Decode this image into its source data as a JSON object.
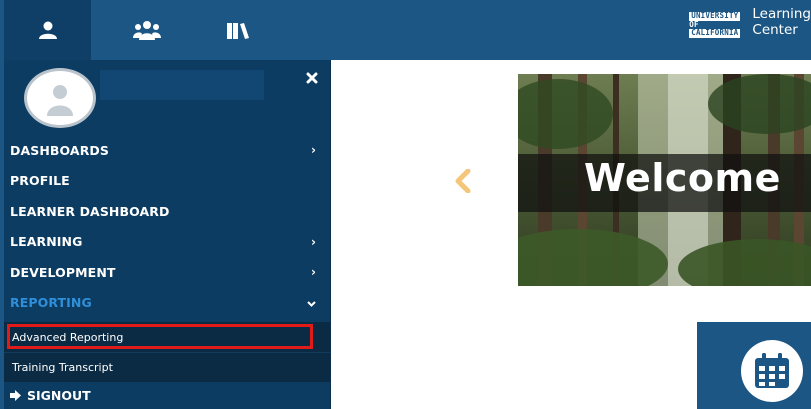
{
  "topbar": {
    "tabs": [
      {
        "icon": "user-icon",
        "active": true
      },
      {
        "icon": "users-group-icon",
        "active": false
      },
      {
        "icon": "books-icon",
        "active": false
      }
    ],
    "logo": {
      "line1": "UNIVERSITY",
      "line2": "OF",
      "line3": "CALIFORNIA"
    },
    "app_title_line1": "Learning",
    "app_title_line2": "Center"
  },
  "sidebar": {
    "close_icon": "close-icon",
    "nav": [
      {
        "label": "DASHBOARDS",
        "chevron": "right"
      },
      {
        "label": "PROFILE",
        "chevron": null
      },
      {
        "label": "LEARNER DASHBOARD",
        "chevron": null
      },
      {
        "label": "LEARNING",
        "chevron": "right"
      },
      {
        "label": "DEVELOPMENT",
        "chevron": "right"
      },
      {
        "label": "REPORTING",
        "chevron": "down",
        "active": true
      }
    ],
    "submenu": [
      {
        "label": "Advanced Reporting",
        "highlighted": true
      },
      {
        "label": "Training Transcript"
      }
    ],
    "signout_label": "SIGNOUT"
  },
  "main": {
    "banner_text": "Welcome",
    "prev_arrow_icon": "chevron-left-icon",
    "tile_icon": "calendar-icon"
  },
  "colors": {
    "topbar": "#1c5684",
    "sidebar": "#0d3c62",
    "active_nav": "#2f8fd8",
    "highlight": "#e11a1a",
    "arrow": "#f3c67a"
  }
}
